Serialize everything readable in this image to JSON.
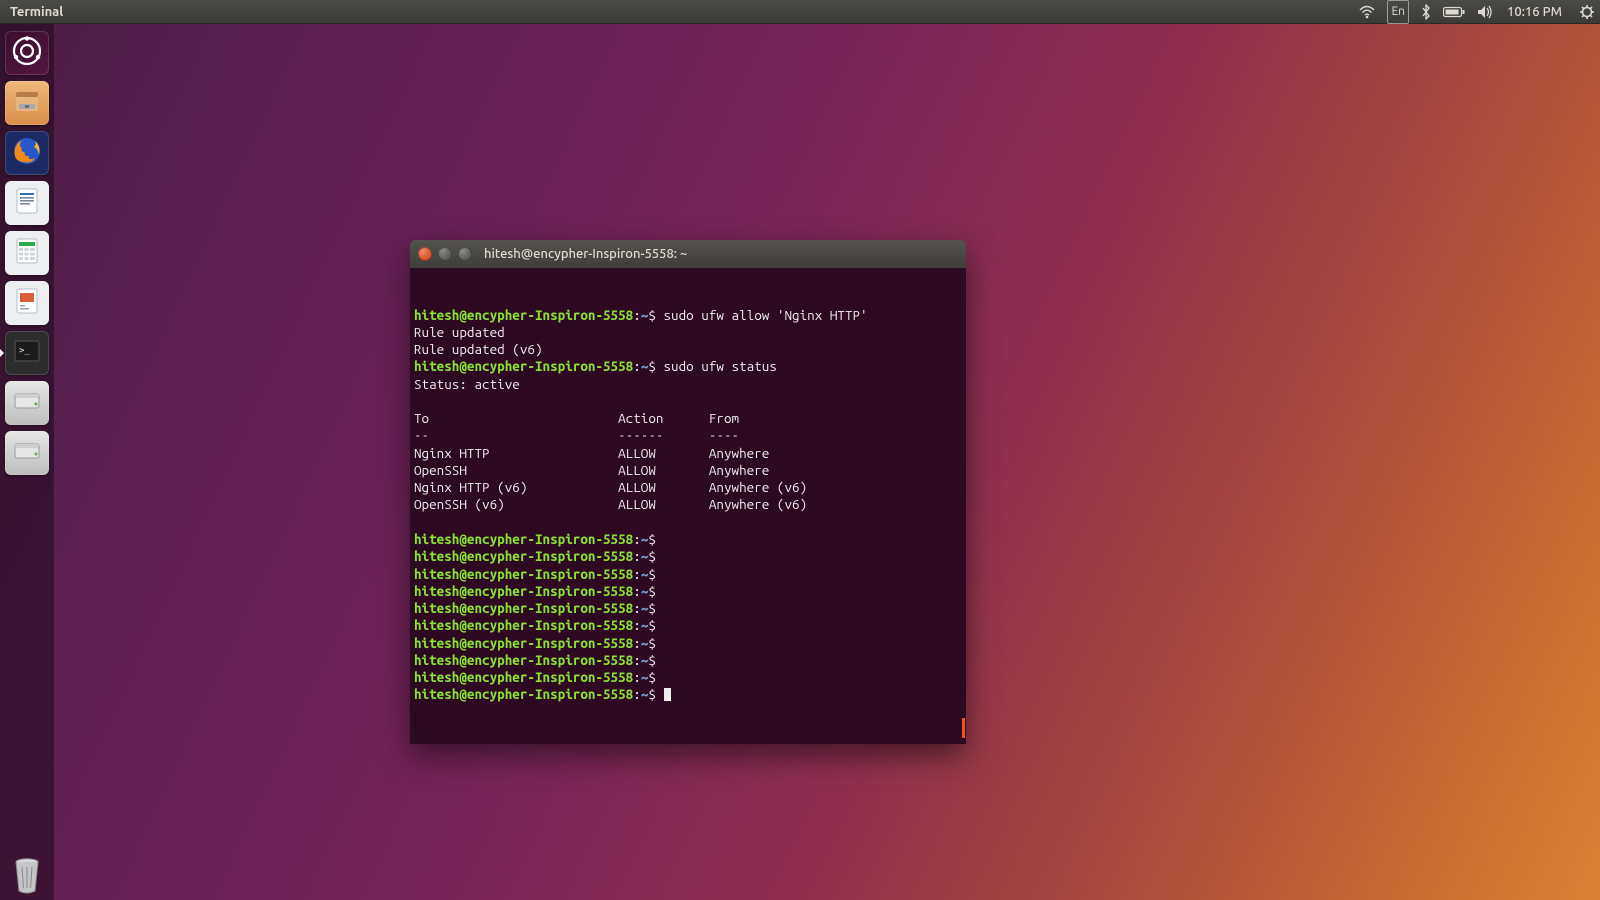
{
  "menubar": {
    "app_title": "Terminal",
    "lang": "En",
    "clock": "10:16 PM"
  },
  "launcher": {
    "items": [
      {
        "id": "dash",
        "name": "dash-icon"
      },
      {
        "id": "files",
        "name": "files-icon"
      },
      {
        "id": "firefox",
        "name": "firefox-icon"
      },
      {
        "id": "writer",
        "name": "libreoffice-writer-icon"
      },
      {
        "id": "calc",
        "name": "libreoffice-calc-icon"
      },
      {
        "id": "impress",
        "name": "libreoffice-impress-icon"
      },
      {
        "id": "terminal",
        "name": "terminal-icon",
        "running": true
      },
      {
        "id": "disk1",
        "name": "drive-icon"
      },
      {
        "id": "disk2",
        "name": "drive-icon"
      }
    ],
    "trash_name": "trash-icon"
  },
  "terminal": {
    "title": "hitesh@encypher-Inspiron-5558: ~",
    "prompt": {
      "user_host": "hitesh@encypher-Inspiron-5558",
      "sep": ":",
      "path": "~",
      "sigil": "$"
    },
    "lines": [
      {
        "t": "cmd",
        "text": "sudo ufw allow 'Nginx HTTP'"
      },
      {
        "t": "out",
        "text": "Rule updated"
      },
      {
        "t": "out",
        "text": "Rule updated (v6)"
      },
      {
        "t": "cmd",
        "text": "sudo ufw status"
      },
      {
        "t": "out",
        "text": "Status: active"
      },
      {
        "t": "blank"
      },
      {
        "t": "out",
        "text": "To                         Action      From"
      },
      {
        "t": "out",
        "text": "--                         ------      ----"
      },
      {
        "t": "out",
        "text": "Nginx HTTP                 ALLOW       Anywhere"
      },
      {
        "t": "out",
        "text": "OpenSSH                    ALLOW       Anywhere"
      },
      {
        "t": "out",
        "text": "Nginx HTTP (v6)            ALLOW       Anywhere (v6)"
      },
      {
        "t": "out",
        "text": "OpenSSH (v6)               ALLOW       Anywhere (v6)"
      },
      {
        "t": "blank"
      },
      {
        "t": "cmd",
        "text": ""
      },
      {
        "t": "cmd",
        "text": ""
      },
      {
        "t": "cmd",
        "text": ""
      },
      {
        "t": "cmd",
        "text": ""
      },
      {
        "t": "cmd",
        "text": ""
      },
      {
        "t": "cmd",
        "text": ""
      },
      {
        "t": "cmd",
        "text": ""
      },
      {
        "t": "cmd",
        "text": ""
      },
      {
        "t": "cmd",
        "text": ""
      },
      {
        "t": "cmd",
        "text": "",
        "cursor": true
      }
    ]
  }
}
